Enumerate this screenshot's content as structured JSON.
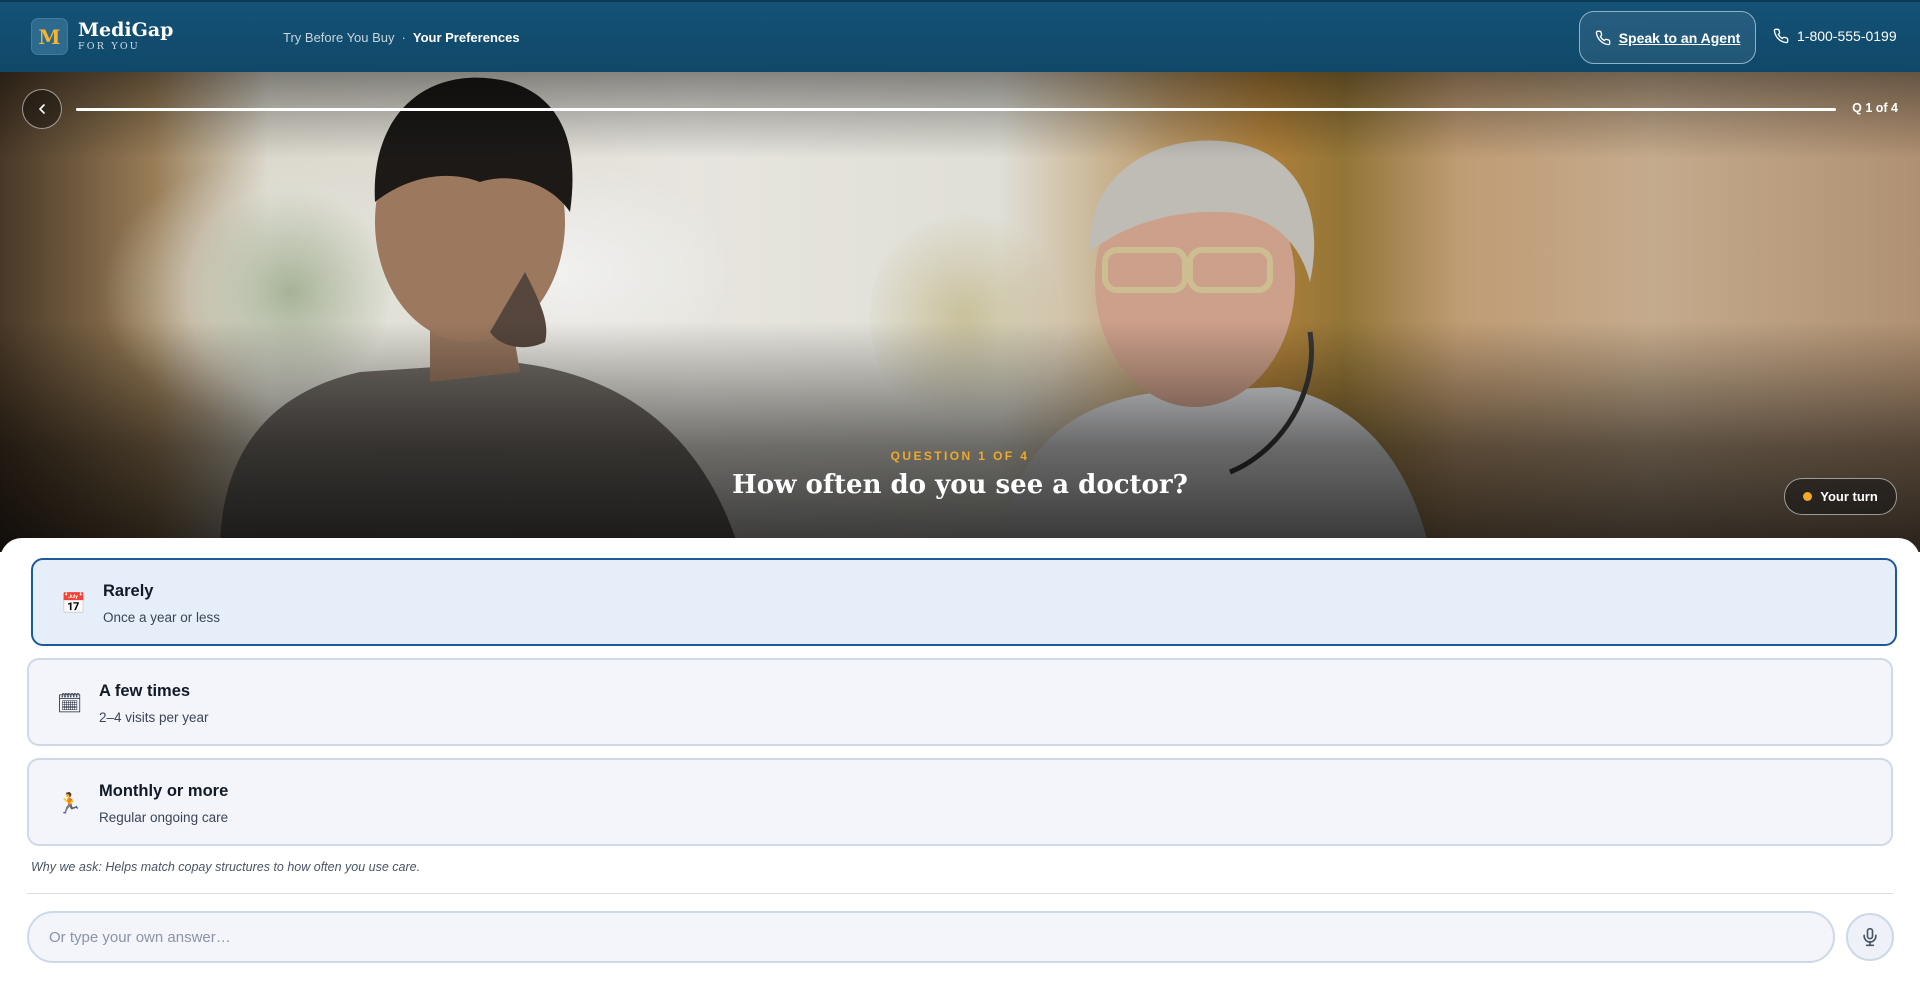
{
  "header": {
    "logo_mark": "M",
    "logo_name": "MediGap",
    "logo_sub": "FOR YOU",
    "breadcrumb": {
      "step1": "Try Before You Buy",
      "separator": "·",
      "step2": "Your Preferences"
    },
    "agent_button": "Speak to an Agent",
    "phone": "1-800-555-0199",
    "colors": {
      "bar": "#145277",
      "accent": "#f2b437"
    }
  },
  "hero": {
    "progress_fraction": 1.0,
    "counter": "Q 1 of 4",
    "eyebrow": "QUESTION 1 OF 4",
    "question": "How often do you see a doctor?",
    "turn_label": "Your turn",
    "turn_dot_color": "#f0a928",
    "back_icon": "chevron-left-icon"
  },
  "options": [
    {
      "icon": "calendar-icon",
      "glyph": "📅",
      "title": "Rarely",
      "subtitle": "Once a year or less",
      "selected": true
    },
    {
      "icon": "notepad-calendar-icon",
      "glyph": "🗓",
      "title": "A few times",
      "subtitle": "2–4 visits per year",
      "selected": false
    },
    {
      "icon": "running-person-icon",
      "glyph": "🏃",
      "title": "Monthly or more",
      "subtitle": "Regular ongoing care",
      "selected": false
    }
  ],
  "why_note": "Why we ask: Helps match copay structures to how often you use care.",
  "input": {
    "value": "",
    "placeholder": "Or type your own answer…",
    "mic_icon": "microphone-icon"
  }
}
